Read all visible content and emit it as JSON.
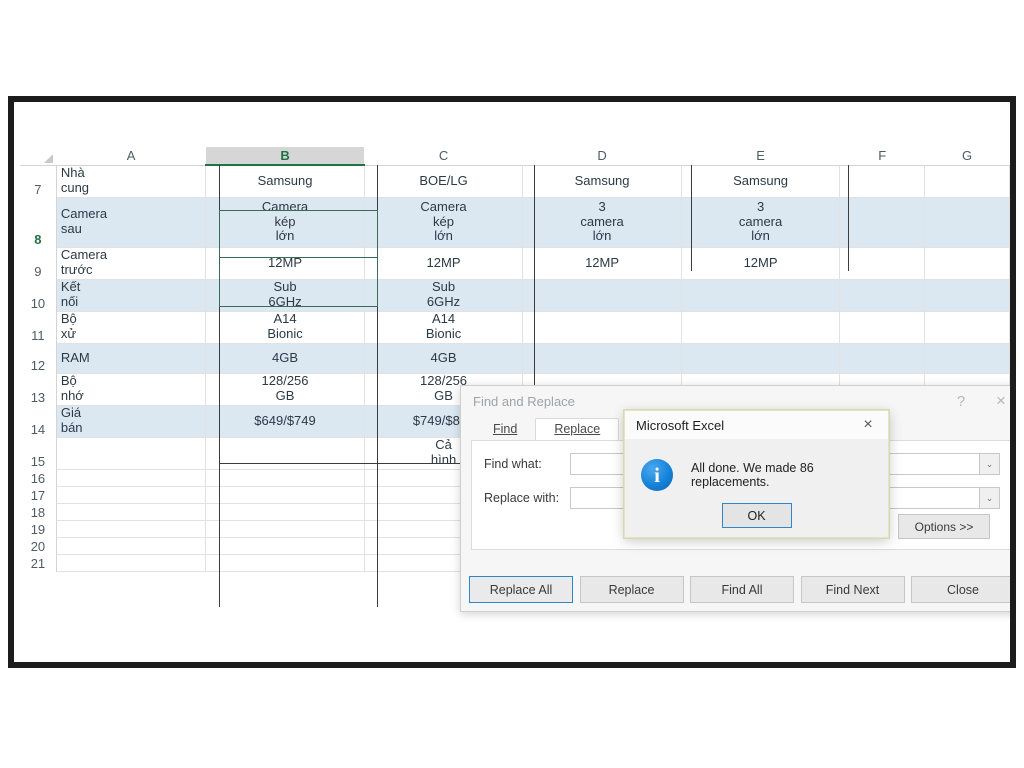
{
  "spreadsheet": {
    "columns": [
      "A",
      "B",
      "C",
      "D",
      "E",
      "F",
      "G"
    ],
    "selected_column": "B",
    "selected_row": "8",
    "rows": [
      {
        "num": "7",
        "band": false,
        "cells": [
          "Nhà\ncung",
          "Samsung",
          "BOE/LG",
          "Samsung",
          "Samsung",
          "",
          ""
        ]
      },
      {
        "num": "8",
        "band": true,
        "cells": [
          "Camera\nsau",
          "Camera\nkép\nlớn",
          "Camera\nkép\nlớn",
          "3\ncamera\nlớn",
          "3\ncamera\nlớn",
          "",
          ""
        ]
      },
      {
        "num": "9",
        "band": false,
        "cells": [
          "Camera\ntrước",
          "12MP",
          "12MP",
          "12MP",
          "12MP",
          "",
          ""
        ]
      },
      {
        "num": "10",
        "band": true,
        "cells": [
          "Kết\nnối",
          "Sub\n6GHz",
          "Sub\n6GHz",
          "",
          "",
          "",
          ""
        ]
      },
      {
        "num": "11",
        "band": false,
        "cells": [
          "Bộ\nxử",
          "A14\nBionic",
          "A14\nBionic",
          "",
          "",
          "",
          ""
        ]
      },
      {
        "num": "12",
        "band": true,
        "cells": [
          "RAM",
          "4GB",
          "4GB",
          "",
          "",
          "",
          ""
        ]
      },
      {
        "num": "13",
        "band": false,
        "cells": [
          "Bộ\nnhớ",
          "128/256\nGB",
          "128/256\nGB",
          "",
          "",
          "",
          ""
        ]
      },
      {
        "num": "14",
        "band": true,
        "cells": [
          "Giá\nbán",
          "$649/$749",
          "$749/$849",
          "",
          "",
          "",
          ""
        ]
      },
      {
        "num": "15",
        "band": false,
        "cells": [
          "",
          "",
          "Cả\nhình",
          "",
          "",
          "",
          ""
        ]
      },
      {
        "num": "16",
        "band": false,
        "cells": [
          "",
          "",
          "",
          "",
          "",
          "",
          ""
        ]
      },
      {
        "num": "17",
        "band": false,
        "cells": [
          "",
          "",
          "",
          "",
          "",
          "",
          ""
        ]
      },
      {
        "num": "18",
        "band": false,
        "cells": [
          "",
          "",
          "",
          "",
          "",
          "",
          ""
        ]
      },
      {
        "num": "19",
        "band": false,
        "cells": [
          "",
          "",
          "",
          "",
          "",
          "",
          ""
        ]
      },
      {
        "num": "20",
        "band": false,
        "cells": [
          "",
          "",
          "",
          "",
          "",
          "",
          ""
        ]
      },
      {
        "num": "21",
        "band": false,
        "cells": [
          "",
          "",
          "",
          "",
          "",
          "",
          ""
        ]
      }
    ]
  },
  "find_replace_dialog": {
    "title": "Find and Replace",
    "help_icon": "?",
    "close_icon": "×",
    "tabs": [
      {
        "label": "Find",
        "active": false
      },
      {
        "label": "Replace",
        "active": true
      }
    ],
    "find_what_label": "Find what:",
    "find_what_value": "",
    "replace_with_label": "Replace with:",
    "replace_with_value": "",
    "dropdown_icon": "⌄",
    "options_button": "Options >>",
    "buttons": [
      {
        "label": "Replace All",
        "focused": true
      },
      {
        "label": "Replace",
        "focused": false
      },
      {
        "label": "Find All",
        "focused": false
      },
      {
        "label": "Find Next",
        "focused": false
      },
      {
        "label": "Close",
        "focused": false
      }
    ]
  },
  "message_box": {
    "title": "Microsoft Excel",
    "close_icon": "×",
    "icon": "info-icon",
    "icon_glyph": "i",
    "message": "All done. We made 86 replacements.",
    "ok_button": "OK"
  },
  "colors": {
    "excel_green": "#217346",
    "band_blue": "#dbe8f2",
    "focus_blue": "#2f86c8",
    "info_blue": "#1683d8",
    "frame_dark": "#1c1c1c"
  }
}
